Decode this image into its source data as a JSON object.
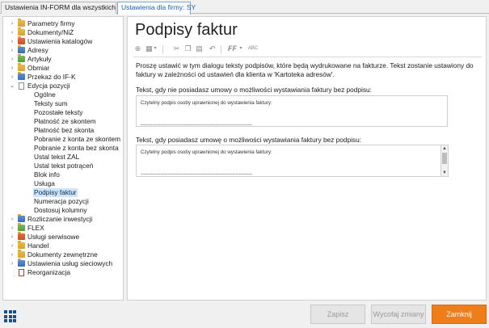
{
  "tabs": [
    {
      "label": "Ustawienia IN-FORM dla wszystkich firm"
    },
    {
      "label": "Ustawienia dla firmy: SY"
    }
  ],
  "tree": {
    "items": [
      {
        "label": "Parametry firmy",
        "arrow": "›"
      },
      {
        "label": "Dokumenty/NiŻ",
        "arrow": "›"
      },
      {
        "label": "Ustawienia katalogów",
        "arrow": "›"
      },
      {
        "label": "Adresy",
        "arrow": "›"
      },
      {
        "label": "Artykuły",
        "arrow": "›"
      },
      {
        "label": "Obmiar",
        "arrow": "›"
      },
      {
        "label": "Przekaz do IF-K",
        "arrow": "›"
      },
      {
        "label": "Edycja pozycji",
        "arrow": "⌄"
      },
      {
        "label": "Ogólne"
      },
      {
        "label": "Teksty sum"
      },
      {
        "label": "Pozostałe teksty"
      },
      {
        "label": "Płatność ze skontem"
      },
      {
        "label": "Płatność bez skonta"
      },
      {
        "label": "Pobranie z konta ze skontem"
      },
      {
        "label": "Pobranie z konta bez skonta"
      },
      {
        "label": "Ustal tekst ZAL"
      },
      {
        "label": "Ustal tekst potrąceń"
      },
      {
        "label": "Blok info"
      },
      {
        "label": "Usługa"
      },
      {
        "label": "Podpisy faktur"
      },
      {
        "label": "Numeracja pozycji"
      },
      {
        "label": "Dostosuj kolumny"
      },
      {
        "label": "Rozliczanie inwestycji",
        "arrow": "›"
      },
      {
        "label": "FLEX",
        "arrow": "›"
      },
      {
        "label": "Usługi serwisowe",
        "arrow": "›"
      },
      {
        "label": "Handel",
        "arrow": "›"
      },
      {
        "label": "Dokumenty zewnętrzne",
        "arrow": "›"
      },
      {
        "label": "Ustawienia usług sieciowych",
        "arrow": "›"
      },
      {
        "label": "Reorganizacja"
      }
    ]
  },
  "main": {
    "title": "Podpisy faktur",
    "toolbar_icons": [
      "insert-icon",
      "table-icon",
      "cut-icon",
      "copy-icon",
      "paste-icon",
      "undo-icon",
      "font-icon",
      "spellcheck-icon"
    ],
    "toolbar_glyphs": {
      "font": "FF",
      "spell": "ABC"
    },
    "intro": "Proszę ustawić w tym dialogu teksty podpisów, które będą wydrukowane na fakturze. Tekst zostanie ustawiony do faktury w zależności od ustawień dla klienta w 'Kartoteka adresów'.",
    "field1": {
      "label": "Tekst, gdy nie posiadasz umowy o możliwości wystawiania faktury bez podpisu:",
      "value": "Czytelny podpis osoby uprawnionej do wystawienia faktury:\n\n\n-------------------------------------------------------------------"
    },
    "field2": {
      "label": "Tekst, gdy posiadasz umowę o możliwości wystawiania faktury bez podpisu:",
      "value": "Czytelny podpis osoby uprawnionej do wystawienia faktury:\n\n\n-------------------------------------------------------------------"
    }
  },
  "buttons": {
    "save": "Zapisz",
    "revert": "Wycofaj zmiany",
    "close": "Zamknij"
  },
  "colors": {
    "accent": "#ef7d1a",
    "selection": "#cde4fb",
    "tab_active": "#1a5fb4"
  }
}
